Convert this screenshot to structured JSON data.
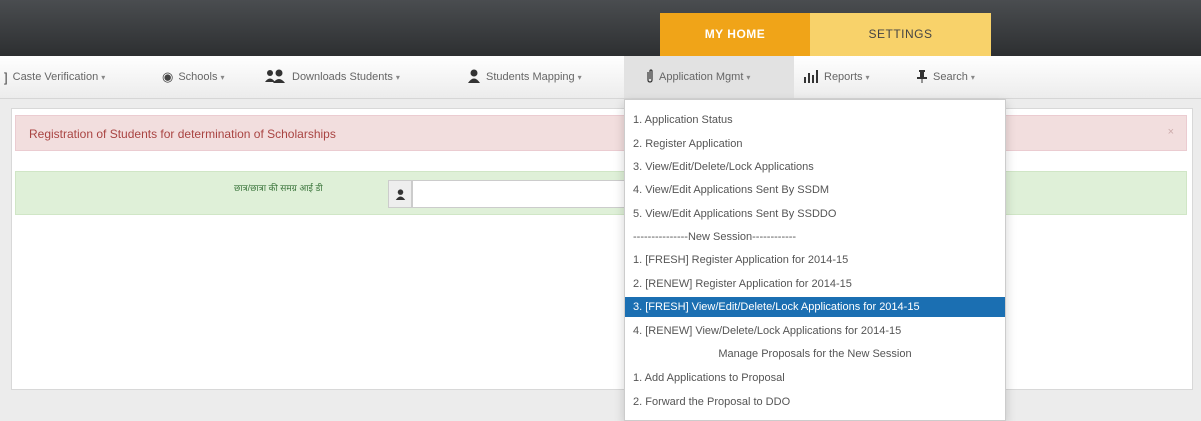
{
  "header": {
    "tabs": [
      {
        "label": "MY HOME",
        "active": true
      },
      {
        "label": "SETTINGS",
        "active": false
      }
    ]
  },
  "nav": {
    "items": [
      {
        "label": "Caste Verification",
        "icon": "bracket-icon"
      },
      {
        "label": "Schools",
        "icon": "target-icon"
      },
      {
        "label": "Downloads Students",
        "icon": "users-icon"
      },
      {
        "label": "Students Mapping",
        "icon": "user-icon"
      },
      {
        "label": "Application Mgmt",
        "icon": "paperclip-icon"
      },
      {
        "label": "Reports",
        "icon": "bar-chart-icon"
      },
      {
        "label": "Search",
        "icon": "pin-icon"
      }
    ],
    "caret": "▾"
  },
  "alert": {
    "text": "Registration of Students for determination of Scholarships",
    "close": "×"
  },
  "form": {
    "label": "छात्र/छात्रा की समग्र आई डी",
    "input_value": ""
  },
  "dropdown": {
    "items": [
      "1. Application Status",
      "2. Register Application",
      "3. View/Edit/Delete/Lock Applications",
      "4. View/Edit Applications Sent By SSDM",
      "5. View/Edit Applications Sent By SSDDO",
      "---------------New Session------------",
      "1. [FRESH] Register Application for 2014-15",
      "2. [RENEW] Register Application for 2014-15",
      "3. [FRESH] View/Edit/Delete/Lock Applications for 2014-15",
      "4. [RENEW] View/Delete/Lock Applications for 2014-15",
      "Manage Proposals for the New Session",
      "1. Add Applications to Proposal",
      "2. Forward the Proposal to DDO"
    ]
  },
  "colors": {
    "home_tab": "#f0a418",
    "settings_tab": "#f8d26a",
    "selected_item": "#1b6fb2"
  }
}
